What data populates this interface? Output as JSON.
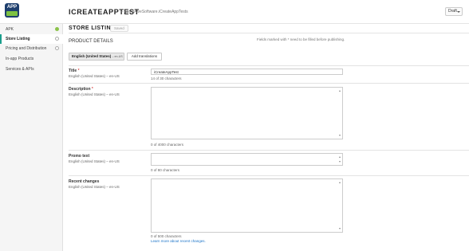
{
  "header": {
    "app_icon_text": "APP",
    "title": "ICREATEAPPTEST",
    "package": "– com.iAlveSoftware.iCreateAppTests",
    "status_dropdown": "Draft"
  },
  "sidebar": {
    "items": [
      {
        "label": "APK",
        "status": "ok"
      },
      {
        "label": "Store Listing",
        "status": "pending",
        "active": true
      },
      {
        "label": "Pricing and Distribution",
        "status": "pending"
      },
      {
        "label": "In-app Products"
      },
      {
        "label": "Services & APIs"
      }
    ]
  },
  "main": {
    "section_title": "STORE LISTING",
    "saved_badge": "Saved",
    "product_details": "PRODUCT DETAILS",
    "required_note": "Fields marked with * need to be filled before publishing.",
    "language_button": {
      "label": "English (United States)",
      "code": "– en-US"
    },
    "add_translations": "Add translations",
    "fields": {
      "title": {
        "label": "Title",
        "required": "*",
        "sublabel": "English (United States) – en-US",
        "value": "iCreateAppTest",
        "counter": "14 of 30 characters"
      },
      "description": {
        "label": "Description",
        "required": "*",
        "sublabel": "English (United States) – en-US",
        "value": "",
        "counter": "0 of 4000 characters"
      },
      "promo": {
        "label": "Promo text",
        "sublabel": "English (United States) – en-US",
        "value": "",
        "counter": "0 of 80 characters"
      },
      "recent": {
        "label": "Recent changes",
        "sublabel": "English (United States) – en-US",
        "value": "",
        "counter": "0 of 500 characters",
        "link": "Learn more about recent changes."
      }
    }
  }
}
